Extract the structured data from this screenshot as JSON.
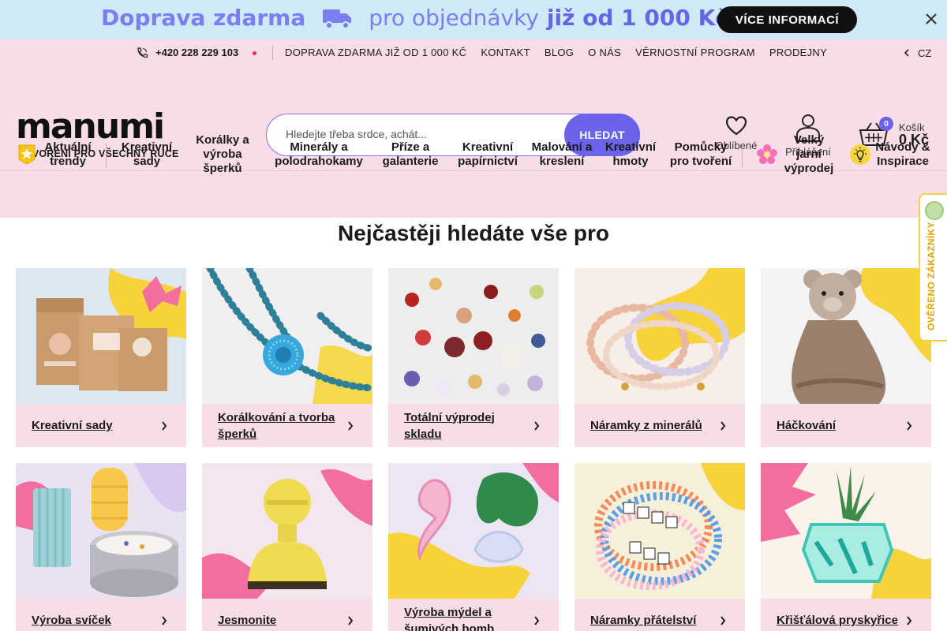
{
  "promo": {
    "text_part1": "Doprava zdarma",
    "text_part2": "pro objednávky",
    "text_part3": "již od 1 000 Kč",
    "button": "VÍCE INFORMACÍ"
  },
  "topbar": {
    "phone": "+420 228 229 103",
    "links": [
      "DOPRAVA ZDARMA JIŽ OD 1 000 KČ",
      "KONTAKT",
      "BLOG",
      "O NÁS",
      "VĚRNOSTNÍ PROGRAM",
      "PRODEJNY"
    ],
    "language": "CZ"
  },
  "header": {
    "logo": "manumi",
    "tagline": "TVOŘENÍ PRO VŠECHNY RUCE",
    "search_placeholder": "Hledejte třeba srdce, achát...",
    "search_button": "HLEDAT",
    "favorites_label": "Oblíbené",
    "login_label": "Přihlášení",
    "cart_label": "Košík",
    "cart_total": "0 Kč",
    "cart_count": "0"
  },
  "categories": [
    "Aktuální trendy",
    "Kreativní sady",
    "Korálky a výroba šperků",
    "Minerály a polodrahokamy",
    "Příze a galanterie",
    "Kreativní papírnictví",
    "Malování a kreslení",
    "Kreativní hmoty",
    "Pomůcky pro tvoření",
    "Velký jarní výprodej",
    "Návody & Inspirace"
  ],
  "section": {
    "title": "Nejčastěji hledáte vše pro",
    "cards": [
      "Kreativní sady",
      "Korálkování a tvorba šperků",
      "Totální výprodej skladu",
      "Náramky z minerálů",
      "Háčkování",
      "Výroba svíček",
      "Jesmonite",
      "Výroba mýdel a šumivých bomb",
      "Náramky přátelství",
      "Křišťálová pryskyřice"
    ]
  },
  "verified_badge": "OVĚŘENO ZÁKAZNÍKY",
  "colors": {
    "pink": "#f8dde8",
    "accent": "#6b63ea",
    "promo_bg": "#cfe9f5"
  }
}
